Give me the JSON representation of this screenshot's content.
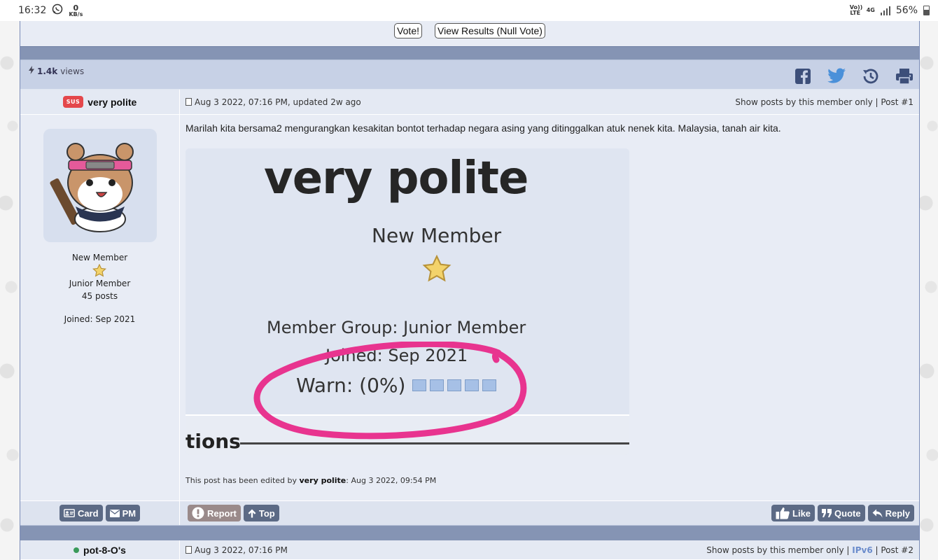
{
  "statusbar": {
    "time": "16:32",
    "net_speed_value": "0",
    "net_speed_unit": "KB/s",
    "volte": "Vo)) LTE",
    "network": "4G",
    "battery": "56%"
  },
  "poll": {
    "vote_label": "Vote!",
    "results_label": "View Results (Null Vote)"
  },
  "topic": {
    "views_count": "1.4k",
    "views_label": "views"
  },
  "post1": {
    "badge": "SUS",
    "author": "very polite",
    "date": "Aug 3 2022, 07:16 PM, updated 2w ago",
    "show_member_only": "Show posts by this member only",
    "post_number": "Post #1",
    "rank_title": "New Member",
    "group": "Junior Member",
    "post_count": "45 posts",
    "joined": "Joined: Sep 2021",
    "text": "Marilah kita bersama2 mengurangkan kesakitan bontot terhadap negara asing yang ditinggalkan atuk nenek kita. Malaysia, tanah air kita.",
    "image": {
      "name": "very polite",
      "rank": "New Member",
      "group": "Member Group: Junior Member",
      "joined": "Joined: Sep 2021",
      "warn": "Warn: (0%)",
      "footer_text": "tions"
    },
    "edited_prefix": "This post has been edited by",
    "edited_by": "very polite",
    "edited_suffix": ": Aug 3 2022, 09:54 PM",
    "buttons": {
      "card": "Card",
      "pm": "PM",
      "report": "Report",
      "top": "Top",
      "like": "Like",
      "quote": "Quote",
      "reply": "Reply"
    }
  },
  "post2": {
    "author": "pot-8-O's",
    "date": "Aug 3 2022, 07:16 PM",
    "show_member_only": "Show posts by this member only",
    "ipv6": "IPv6",
    "post_number": "Post #2"
  },
  "colors": {
    "header_bar": "#8594b4",
    "sus_badge": "#e4474b",
    "button": "#5c6a85",
    "annotation_circle": "#e8348f"
  }
}
